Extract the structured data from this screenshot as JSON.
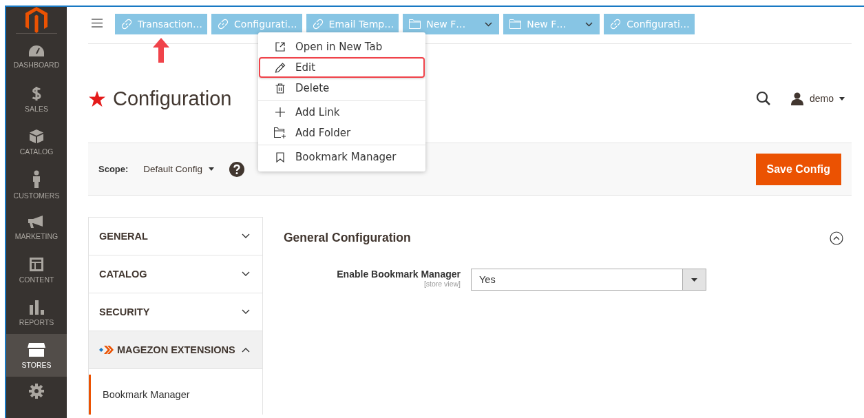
{
  "sidebar": {
    "items": [
      {
        "kind": "dashboard",
        "label": "DASHBOARD",
        "selected": false
      },
      {
        "kind": "sales",
        "label": "SALES",
        "selected": false
      },
      {
        "kind": "catalog",
        "label": "CATALOG",
        "selected": false
      },
      {
        "kind": "customers",
        "label": "CUSTOMERS",
        "selected": false
      },
      {
        "kind": "marketing",
        "label": "MARKETING",
        "selected": false
      },
      {
        "kind": "content",
        "label": "CONTENT",
        "selected": false
      },
      {
        "kind": "reports",
        "label": "REPORTS",
        "selected": false
      },
      {
        "kind": "stores",
        "label": "STORES",
        "selected": true
      }
    ]
  },
  "bookmarks": [
    {
      "kind": "link",
      "label": "Transaction…",
      "annotated": true
    },
    {
      "kind": "link",
      "label": "Configurati…",
      "annotated": false
    },
    {
      "kind": "link",
      "label": "Email Temp…",
      "annotated": false
    },
    {
      "kind": "folder",
      "label": "New F…",
      "annotated": false
    },
    {
      "kind": "folder",
      "label": "New F…",
      "annotated": false
    },
    {
      "kind": "link",
      "label": "Configurati…",
      "annotated": false
    }
  ],
  "context_menu": {
    "groups": [
      [
        {
          "kind": "open",
          "label": "Open in New Tab",
          "highlighted": false
        },
        {
          "kind": "edit",
          "label": "Edit",
          "highlighted": true
        },
        {
          "kind": "delete",
          "label": "Delete",
          "highlighted": false
        }
      ],
      [
        {
          "kind": "add-link",
          "label": "Add Link",
          "highlighted": false
        },
        {
          "kind": "add-folder",
          "label": "Add Folder",
          "highlighted": false
        }
      ],
      [
        {
          "kind": "manager",
          "label": "Bookmark Manager",
          "highlighted": false
        }
      ]
    ]
  },
  "page": {
    "title": "Configuration",
    "bookmarked": true,
    "user": "demo"
  },
  "scope": {
    "label": "Scope:",
    "value": "Default Config"
  },
  "save_button": "Save Config",
  "config_nav": {
    "sections": [
      {
        "kind": "plain",
        "label": "GENERAL",
        "expanded": false
      },
      {
        "kind": "plain",
        "label": "CATALOG",
        "expanded": false
      },
      {
        "kind": "plain",
        "label": "SECURITY",
        "expanded": false
      },
      {
        "kind": "vendor",
        "label": "MAGEZON EXTENSIONS",
        "expanded": true,
        "children": [
          {
            "label": "Bookmark Manager",
            "selected": true
          }
        ]
      }
    ]
  },
  "section": {
    "title": "General Configuration",
    "expanded": true,
    "fields": [
      {
        "label": "Enable Bookmark Manager",
        "scope": "[store view]",
        "value": "Yes"
      }
    ]
  }
}
